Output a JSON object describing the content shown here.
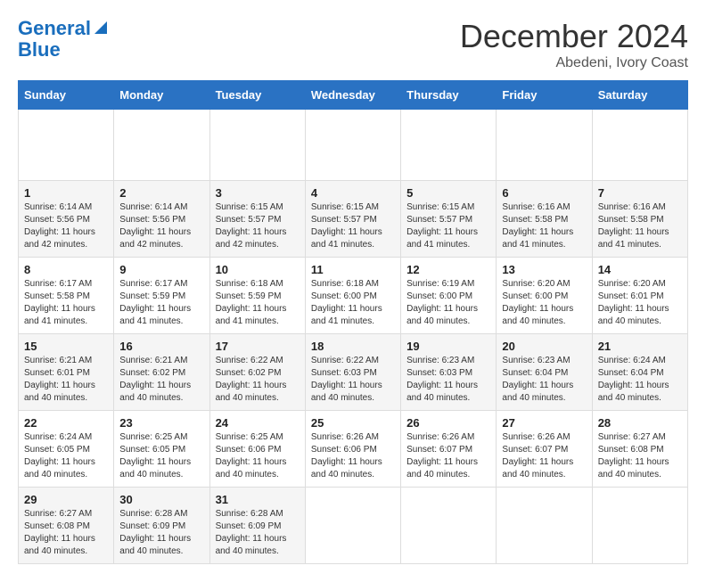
{
  "header": {
    "logo_line1": "General",
    "logo_line2": "Blue",
    "month_title": "December 2024",
    "location": "Abedeni, Ivory Coast"
  },
  "calendar": {
    "days_of_week": [
      "Sunday",
      "Monday",
      "Tuesday",
      "Wednesday",
      "Thursday",
      "Friday",
      "Saturday"
    ],
    "weeks": [
      [
        {
          "day": "",
          "info": ""
        },
        {
          "day": "",
          "info": ""
        },
        {
          "day": "",
          "info": ""
        },
        {
          "day": "",
          "info": ""
        },
        {
          "day": "",
          "info": ""
        },
        {
          "day": "",
          "info": ""
        },
        {
          "day": "",
          "info": ""
        }
      ],
      [
        {
          "day": "1",
          "sunrise": "6:14 AM",
          "sunset": "5:56 PM",
          "daylight": "11 hours and 42 minutes."
        },
        {
          "day": "2",
          "sunrise": "6:14 AM",
          "sunset": "5:56 PM",
          "daylight": "11 hours and 42 minutes."
        },
        {
          "day": "3",
          "sunrise": "6:15 AM",
          "sunset": "5:57 PM",
          "daylight": "11 hours and 42 minutes."
        },
        {
          "day": "4",
          "sunrise": "6:15 AM",
          "sunset": "5:57 PM",
          "daylight": "11 hours and 41 minutes."
        },
        {
          "day": "5",
          "sunrise": "6:15 AM",
          "sunset": "5:57 PM",
          "daylight": "11 hours and 41 minutes."
        },
        {
          "day": "6",
          "sunrise": "6:16 AM",
          "sunset": "5:58 PM",
          "daylight": "11 hours and 41 minutes."
        },
        {
          "day": "7",
          "sunrise": "6:16 AM",
          "sunset": "5:58 PM",
          "daylight": "11 hours and 41 minutes."
        }
      ],
      [
        {
          "day": "8",
          "sunrise": "6:17 AM",
          "sunset": "5:58 PM",
          "daylight": "11 hours and 41 minutes."
        },
        {
          "day": "9",
          "sunrise": "6:17 AM",
          "sunset": "5:59 PM",
          "daylight": "11 hours and 41 minutes."
        },
        {
          "day": "10",
          "sunrise": "6:18 AM",
          "sunset": "5:59 PM",
          "daylight": "11 hours and 41 minutes."
        },
        {
          "day": "11",
          "sunrise": "6:18 AM",
          "sunset": "6:00 PM",
          "daylight": "11 hours and 41 minutes."
        },
        {
          "day": "12",
          "sunrise": "6:19 AM",
          "sunset": "6:00 PM",
          "daylight": "11 hours and 40 minutes."
        },
        {
          "day": "13",
          "sunrise": "6:20 AM",
          "sunset": "6:00 PM",
          "daylight": "11 hours and 40 minutes."
        },
        {
          "day": "14",
          "sunrise": "6:20 AM",
          "sunset": "6:01 PM",
          "daylight": "11 hours and 40 minutes."
        }
      ],
      [
        {
          "day": "15",
          "sunrise": "6:21 AM",
          "sunset": "6:01 PM",
          "daylight": "11 hours and 40 minutes."
        },
        {
          "day": "16",
          "sunrise": "6:21 AM",
          "sunset": "6:02 PM",
          "daylight": "11 hours and 40 minutes."
        },
        {
          "day": "17",
          "sunrise": "6:22 AM",
          "sunset": "6:02 PM",
          "daylight": "11 hours and 40 minutes."
        },
        {
          "day": "18",
          "sunrise": "6:22 AM",
          "sunset": "6:03 PM",
          "daylight": "11 hours and 40 minutes."
        },
        {
          "day": "19",
          "sunrise": "6:23 AM",
          "sunset": "6:03 PM",
          "daylight": "11 hours and 40 minutes."
        },
        {
          "day": "20",
          "sunrise": "6:23 AM",
          "sunset": "6:04 PM",
          "daylight": "11 hours and 40 minutes."
        },
        {
          "day": "21",
          "sunrise": "6:24 AM",
          "sunset": "6:04 PM",
          "daylight": "11 hours and 40 minutes."
        }
      ],
      [
        {
          "day": "22",
          "sunrise": "6:24 AM",
          "sunset": "6:05 PM",
          "daylight": "11 hours and 40 minutes."
        },
        {
          "day": "23",
          "sunrise": "6:25 AM",
          "sunset": "6:05 PM",
          "daylight": "11 hours and 40 minutes."
        },
        {
          "day": "24",
          "sunrise": "6:25 AM",
          "sunset": "6:06 PM",
          "daylight": "11 hours and 40 minutes."
        },
        {
          "day": "25",
          "sunrise": "6:26 AM",
          "sunset": "6:06 PM",
          "daylight": "11 hours and 40 minutes."
        },
        {
          "day": "26",
          "sunrise": "6:26 AM",
          "sunset": "6:07 PM",
          "daylight": "11 hours and 40 minutes."
        },
        {
          "day": "27",
          "sunrise": "6:26 AM",
          "sunset": "6:07 PM",
          "daylight": "11 hours and 40 minutes."
        },
        {
          "day": "28",
          "sunrise": "6:27 AM",
          "sunset": "6:08 PM",
          "daylight": "11 hours and 40 minutes."
        }
      ],
      [
        {
          "day": "29",
          "sunrise": "6:27 AM",
          "sunset": "6:08 PM",
          "daylight": "11 hours and 40 minutes."
        },
        {
          "day": "30",
          "sunrise": "6:28 AM",
          "sunset": "6:09 PM",
          "daylight": "11 hours and 40 minutes."
        },
        {
          "day": "31",
          "sunrise": "6:28 AM",
          "sunset": "6:09 PM",
          "daylight": "11 hours and 40 minutes."
        },
        {
          "day": "",
          "info": ""
        },
        {
          "day": "",
          "info": ""
        },
        {
          "day": "",
          "info": ""
        },
        {
          "day": "",
          "info": ""
        }
      ]
    ]
  }
}
